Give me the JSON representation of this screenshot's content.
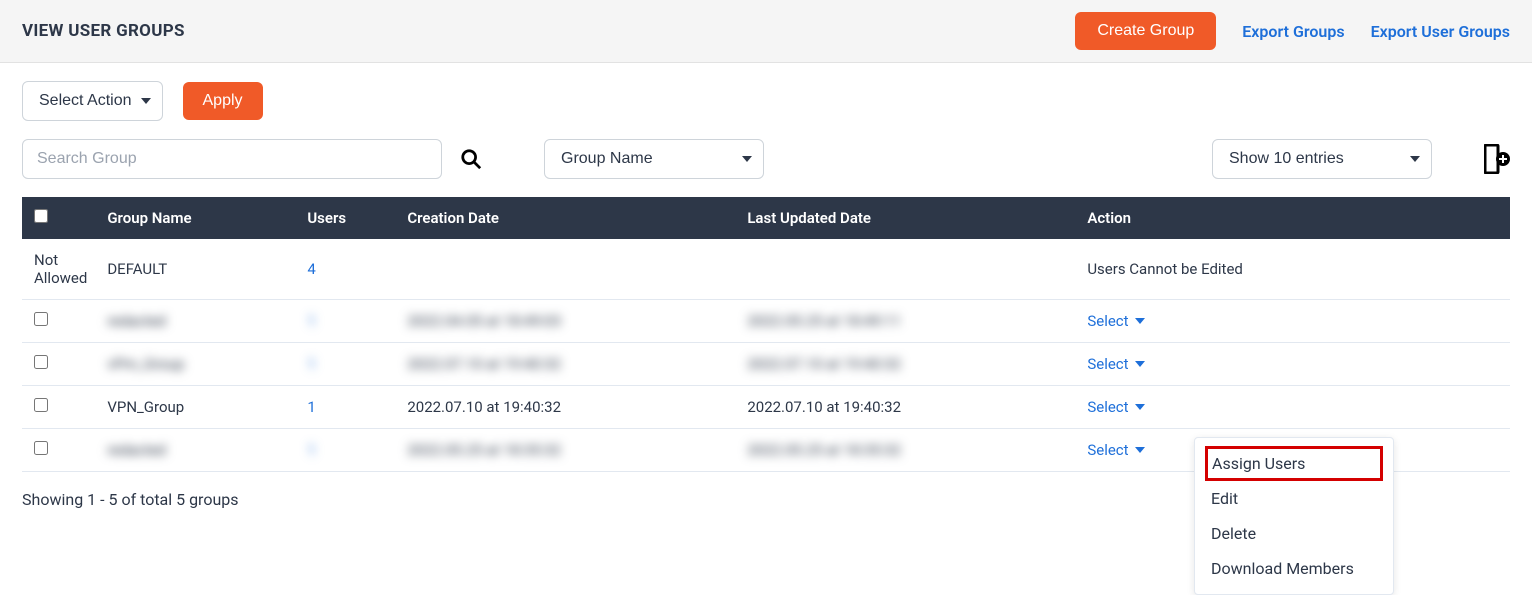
{
  "header": {
    "title": "VIEW USER GROUPS",
    "create_button": "Create Group",
    "export_groups": "Export Groups",
    "export_user_groups": "Export User Groups"
  },
  "toolbar": {
    "select_action": "Select Action",
    "apply": "Apply",
    "search_placeholder": "Search Group",
    "filter_by": "Group Name",
    "page_size": "Show 10 entries"
  },
  "columns": {
    "group_name": "Group Name",
    "users": "Users",
    "creation_date": "Creation Date",
    "last_updated": "Last Updated Date",
    "action": "Action"
  },
  "rows": [
    {
      "selectable_text": "Not Allowed",
      "group_name": "DEFAULT",
      "users": "4",
      "creation_date": "",
      "last_updated": "",
      "action_text": "Users Cannot be Edited",
      "action_type": "static"
    },
    {
      "selectable_text": "",
      "group_name": "redacted",
      "users": "1",
      "creation_date": "2022.04.05 at 18:49:03",
      "last_updated": "2022.05.25 at 18:49:11",
      "action_text": "Select",
      "action_type": "select",
      "blurred": true
    },
    {
      "selectable_text": "",
      "group_name": "vPm_Group",
      "users": "1",
      "creation_date": "2022.07.10 at 19:40:32",
      "last_updated": "2022.07.10 at 19:40:32",
      "action_text": "Select",
      "action_type": "select",
      "blurred": true
    },
    {
      "selectable_text": "",
      "group_name": "VPN_Group",
      "users": "1",
      "creation_date": "2022.07.10 at 19:40:32",
      "last_updated": "2022.07.10 at 19:40:32",
      "action_text": "Select",
      "action_type": "select",
      "menu_open": true
    },
    {
      "selectable_text": "",
      "group_name": "redacted",
      "users": "1",
      "creation_date": "2022.05.25 at 18:35:32",
      "last_updated": "2022.05.25 at 18:35:32",
      "action_text": "Select",
      "action_type": "select",
      "blurred": true
    }
  ],
  "dropdown": {
    "assign_users": "Assign Users",
    "edit": "Edit",
    "delete": "Delete",
    "download_members": "Download Members"
  },
  "footer": {
    "summary": "Showing 1 - 5 of total 5 groups"
  }
}
